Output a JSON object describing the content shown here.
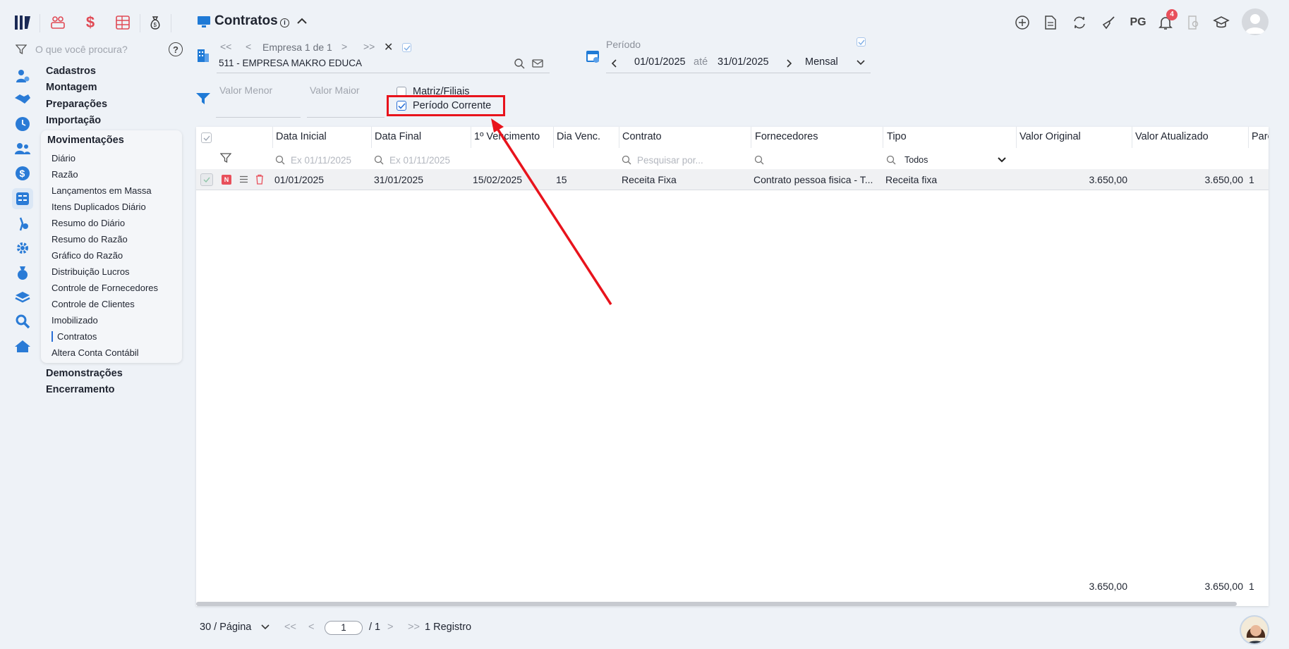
{
  "topbar": {
    "title": "Contratos",
    "search_placeholder": "O que você procura?",
    "pg_label": "PG",
    "notification_count": "4"
  },
  "nav": {
    "groups_top": [
      "Cadastros",
      "Montagem",
      "Preparações",
      "Importação"
    ],
    "active_group": "Movimentações",
    "items": [
      "Diário",
      "Razão",
      "Lançamentos em Massa",
      "Itens Duplicados Diário",
      "Resumo do Diário",
      "Resumo do Razão",
      "Gráfico do Razão",
      "Distribuição Lucros",
      "Controle de Fornecedores",
      "Controle de Clientes",
      "Imobilizado",
      "Contratos",
      "Altera Conta Contábil"
    ],
    "groups_bottom": [
      "Demonstrações",
      "Encerramento"
    ]
  },
  "empresa": {
    "nav_label": "Empresa 1 de 1",
    "value": "511 - EMPRESA MAKRO EDUCA"
  },
  "periodo": {
    "label": "Período",
    "start": "01/01/2025",
    "sep": "até",
    "end": "31/01/2025",
    "mode": "Mensal"
  },
  "filters": {
    "valor_menor": "Valor Menor",
    "valor_maior": "Valor Maior",
    "matriz_filiais": "Matriz/Filiais",
    "periodo_corrente": "Período Corrente"
  },
  "table": {
    "headers": [
      "Data Inicial",
      "Data Final",
      "1º Vencimento",
      "Dia Venc.",
      "Contrato",
      "Fornecedores",
      "Tipo",
      "Valor Original",
      "Valor Atualizado",
      "Parc"
    ],
    "filter_placeholders": {
      "date_ini": "Ex 01/11/2025",
      "date_fin": "Ex 01/11/2025",
      "contrato": "Pesquisar por...",
      "tipo": "Todos"
    },
    "row": {
      "badge": "N",
      "data_inicial": "01/01/2025",
      "data_final": "31/01/2025",
      "vencimento": "15/02/2025",
      "dia_venc": "15",
      "contrato": "Receita Fixa",
      "fornecedor": "Contrato pessoa fisica - T...",
      "tipo": "Receita fixa",
      "valor_original": "3.650,00",
      "valor_atualizado": "3.650,00",
      "parc": "1"
    },
    "totals": {
      "valor_original": "3.650,00",
      "valor_atualizado": "3.650,00",
      "parc": "1"
    }
  },
  "pagination": {
    "per_page": "30 / Página",
    "current": "1",
    "total": "/ 1",
    "records": "1 Registro"
  },
  "colors": {
    "accent": "#2a6fd6",
    "annotation": "#e8131c",
    "badge": "#e8505b"
  }
}
